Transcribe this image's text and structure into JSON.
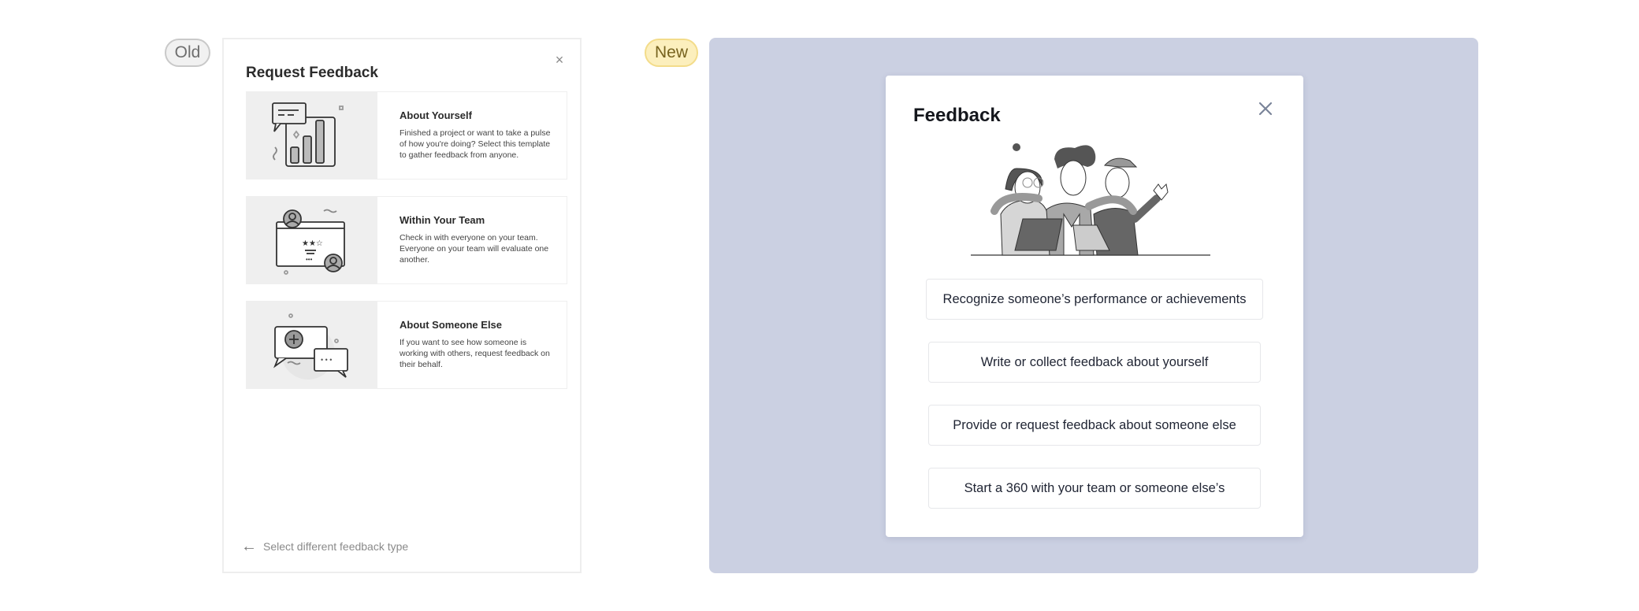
{
  "labels": {
    "old": "Old",
    "new": "New"
  },
  "old_dialog": {
    "title": "Request Feedback",
    "close_icon": "×",
    "cards": [
      {
        "title": "About Yourself",
        "description": "Finished a project or want to take a pulse of how you're doing? Select this template to gather feedback from anyone.",
        "illustration": "bar-chart-with-speech-bubble"
      },
      {
        "title": "Within Your Team",
        "description": "Check in with everyone on your team. Everyone on your team will evaluate one another.",
        "illustration": "team-window-with-avatars"
      },
      {
        "title": "About Someone Else",
        "description": "If you want to see how someone is working with others, request feedback on their behalf.",
        "illustration": "speech-bubbles-with-plus"
      }
    ],
    "back_arrow": "←",
    "back_label": "Select different feedback type"
  },
  "new_dialog": {
    "title": "Feedback",
    "illustration": "three-people-with-laptop",
    "options": [
      "Recognize someone’s performance or achievements",
      "Write or collect feedback about yourself",
      "Provide or request feedback about someone else",
      "Start a 360 with your team or someone else’s"
    ]
  },
  "colors": {
    "new_backdrop": "#cbd0e2",
    "old_pill_bg": "#f1f1f1",
    "new_pill_bg": "#fcefbd",
    "close_icon": "#7a8499"
  }
}
